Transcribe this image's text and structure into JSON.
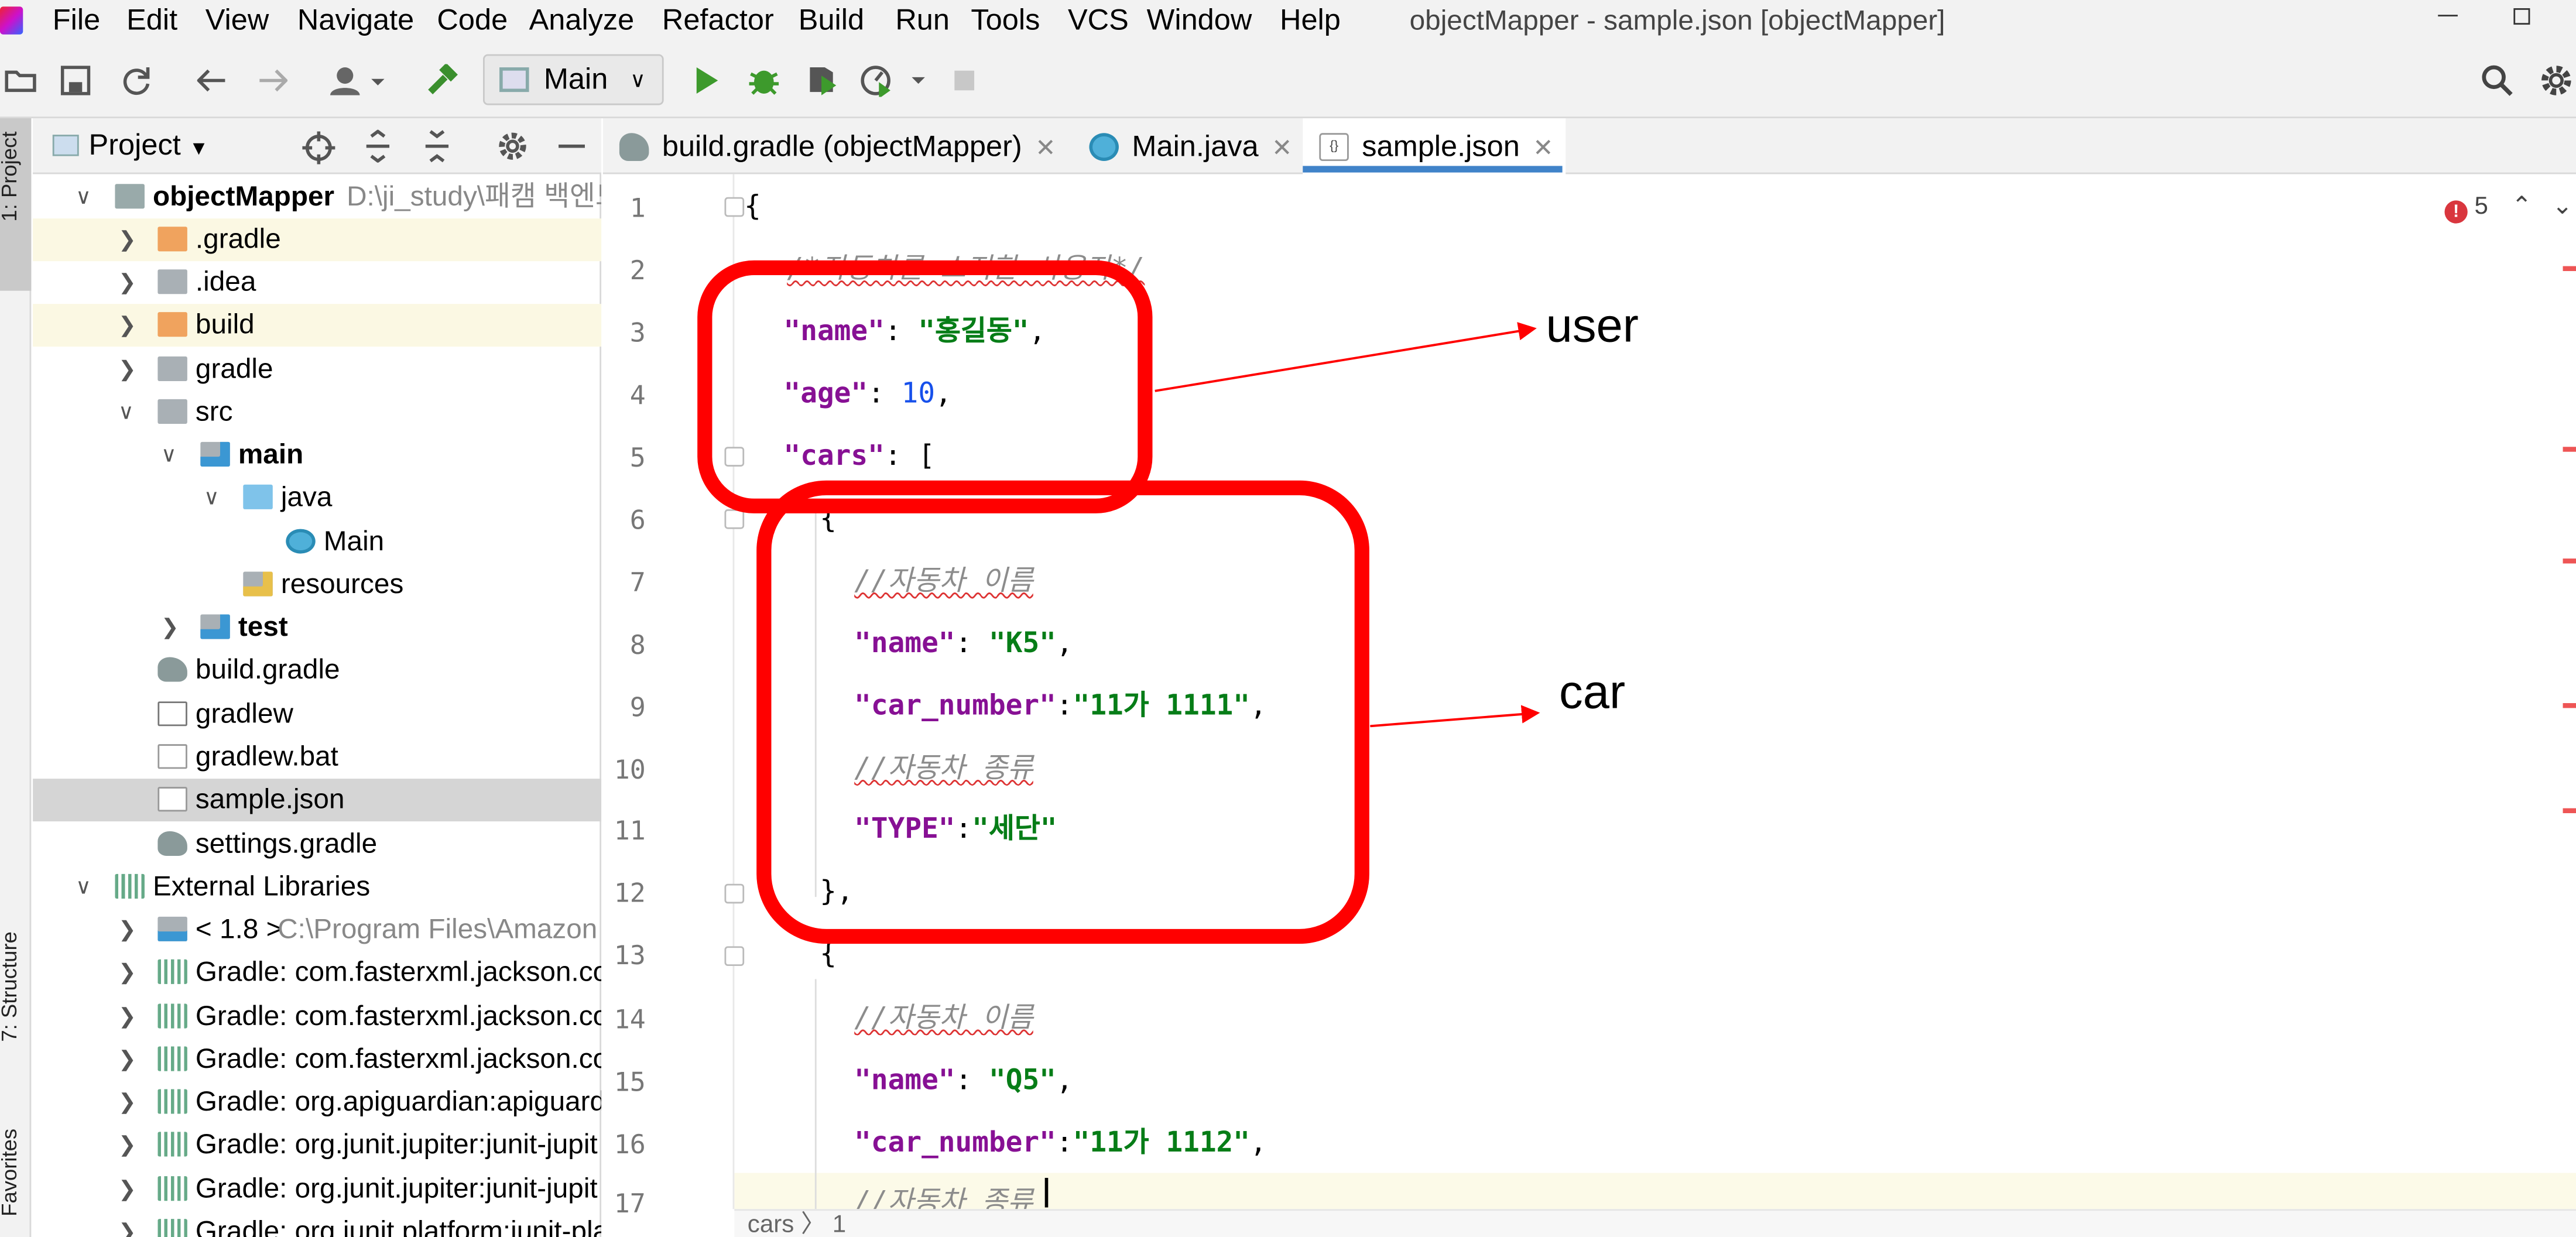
{
  "menu": [
    "File",
    "Edit",
    "View",
    "Navigate",
    "Code",
    "Analyze",
    "Refactor",
    "Build",
    "Run",
    "Tools",
    "VCS",
    "Window",
    "Help"
  ],
  "window_title": "objectMapper - sample.json [objectMapper]",
  "toolbar": {
    "run_config": "Main"
  },
  "side_tabs": {
    "project": "1: Project",
    "structure": "7: Structure",
    "favorites": "Favorites"
  },
  "project_panel": {
    "title": "Project",
    "tree": [
      {
        "label": "objectMapper",
        "hint": "D:\\ji_study\\패캠 백엔드"
      },
      {
        "label": ".gradle"
      },
      {
        "label": ".idea"
      },
      {
        "label": "build"
      },
      {
        "label": "gradle"
      },
      {
        "label": "src"
      },
      {
        "label": "main"
      },
      {
        "label": "java"
      },
      {
        "label": "Main"
      },
      {
        "label": "resources"
      },
      {
        "label": "test"
      },
      {
        "label": "build.gradle"
      },
      {
        "label": "gradlew"
      },
      {
        "label": "gradlew.bat"
      },
      {
        "label": "sample.json"
      },
      {
        "label": "settings.gradle"
      },
      {
        "label": "External Libraries"
      },
      {
        "label": "< 1.8 >",
        "hint": "C:\\Program Files\\Amazon C"
      },
      {
        "label": "Gradle: com.fasterxml.jackson.co"
      },
      {
        "label": "Gradle: com.fasterxml.jackson.co"
      },
      {
        "label": "Gradle: com.fasterxml.jackson.co"
      },
      {
        "label": "Gradle: org.apiguardian:apiguardi"
      },
      {
        "label": "Gradle: org.junit.jupiter:junit-jupit"
      },
      {
        "label": "Gradle: org.junit.jupiter:junit-jupit"
      },
      {
        "label": "Gradle: org.junit.platform:junit-pla"
      }
    ]
  },
  "editor_tabs": [
    {
      "label": "build.gradle (objectMapper)"
    },
    {
      "label": "Main.java"
    },
    {
      "label": "sample.json"
    }
  ],
  "line_numbers": [
    "1",
    "2",
    "3",
    "4",
    "5",
    "6",
    "7",
    "8",
    "9",
    "10",
    "11",
    "12",
    "13",
    "14",
    "15",
    "16",
    "17"
  ],
  "code": {
    "l1": "{",
    "l2": "/*자동차를 소지한 사용자*/",
    "l3k": "\"name\"",
    "l3s": "\"홍길동\"",
    "l4k": "\"age\"",
    "l4n": "10",
    "l5k": "\"cars\"",
    "l5p": ": [",
    "l6": "{",
    "l7": "//자동차 이름",
    "l8k": "\"name\"",
    "l8s": "\"K5\"",
    "l9k": "\"car_number\"",
    "l9s": "\"11가 1111\"",
    "l10": "//자동차 종류",
    "l11k": "\"TYPE\"",
    "l11s": "\"세단\"",
    "l12": "},",
    "l13": "{",
    "l14": "//자동차 이름",
    "l15k": "\"name\"",
    "l15s": "\"Q5\"",
    "l16k": "\"car_number\"",
    "l16s": "\"11가 1112\"",
    "l17": "//자동차 종류"
  },
  "error_count": "5",
  "breadcrumb": "cars  〉 1",
  "annotations": {
    "user": "user",
    "car": "car",
    "color": "#ff0000"
  }
}
